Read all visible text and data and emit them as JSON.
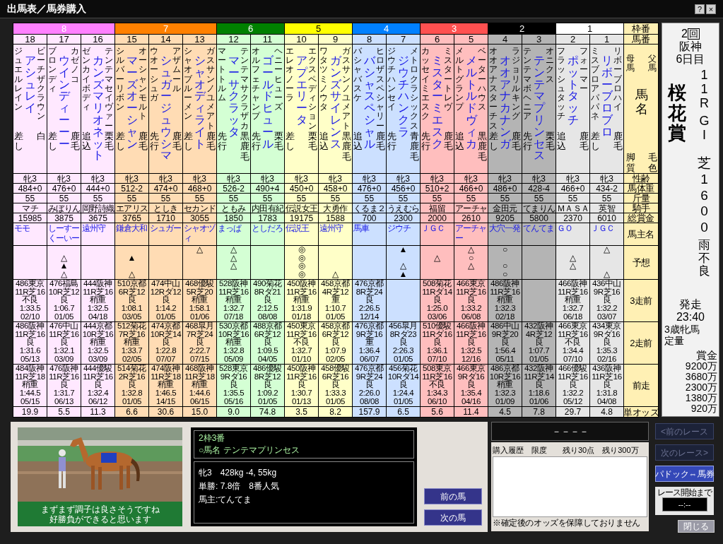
{
  "window": {
    "title": "出馬表／馬券購入",
    "help_button": "?",
    "close_button": "×"
  },
  "row_labels": {
    "frame": "枠番",
    "number": "馬番",
    "sire": "父馬",
    "dam": "母馬",
    "name": "馬名",
    "coat": "毛色",
    "style": "脚質",
    "sex_age": "性齢",
    "weight": "馬体重",
    "load": "斤量",
    "jockey": "騎手",
    "earnings": "総賞金",
    "owner": "馬主名",
    "prediction": "予想",
    "race3": "3走前",
    "race2": "2走前",
    "race1": "前走",
    "odds": "単オッズ"
  },
  "frames": [
    {
      "label": "8",
      "color": "#ff80ff",
      "horses": [
        {
          "number": "18",
          "sire": "ビーチザクラウン",
          "dam": "ジュエルレイン",
          "name": "アシュレイ",
          "style": "差し",
          "coat": "白",
          "sex_age": "牝3",
          "weight": "484+0",
          "load": "55",
          "jockey": "マチ",
          "earnings": "15985",
          "owner": "モモ",
          "predictions": [
            {
              "kind": "blank"
            },
            {
              "kind": "blank"
            },
            {
              "kind": "blank"
            },
            {
              "kind": "blank"
            }
          ],
          "past_races": [
            {
              "venue": "486東京",
              "race": "11R芝16",
              "going": "不良",
              "time": "1:33.5",
              "date": "02/10"
            },
            {
              "venue": "486阪神",
              "race": "11R芝16",
              "going": "良",
              "time": "1:31.6",
              "date": "05/13"
            },
            {
              "venue": "484阪神",
              "race": "11R芝18",
              "going": "稍重",
              "time": "1:44.5",
              "date": "05/15"
            }
          ],
          "odds": "19.9"
        },
        {
          "number": "17",
          "sire": "カゼノコ",
          "dam": "ブロンディ",
          "name": "ウインディーーー",
          "style": "差し",
          "coat": "鹿毛",
          "sex_age": "牝3",
          "weight": "476+0",
          "load": "55",
          "jockey": "みぼりん",
          "earnings": "3875",
          "owner": "しーすーくーいー",
          "predictions": [
            {
              "kind": "blank"
            },
            {
              "kind": "mark",
              "mark": "△"
            },
            {
              "kind": "mark",
              "mark": "▲"
            },
            {
              "kind": "mark",
              "mark": "△"
            }
          ],
          "past_races": [
            {
              "venue": "476福島",
              "race": "10R芝12",
              "going": "良",
              "time": "1:06.7",
              "date": "01/05"
            },
            {
              "venue": "476中山",
              "race": "11R芝16",
              "going": "良",
              "time": "1:32.1",
              "date": "03/09"
            },
            {
              "venue": "476阪神",
              "race": "11R芝16",
              "going": "良",
              "time": "1:31.7",
              "date": "06/13"
            }
          ],
          "odds": "5.5"
        },
        {
          "number": "16",
          "sire": "テンテマセイヴァー",
          "dam": "ゼンカイボディ",
          "name": "カンズマリオネット",
          "style": "追込",
          "coat": "栗毛",
          "sex_age": "牝3",
          "weight": "444+0",
          "load": "55",
          "jockey": "岡野詩織",
          "earnings": "3675",
          "owner": "遠州守",
          "predictions": [
            {
              "kind": "blank"
            },
            {
              "kind": "blank"
            },
            {
              "kind": "blank"
            },
            {
              "kind": "blank"
            }
          ],
          "past_races": [
            {
              "venue": "444阪神",
              "race": "11R芝16",
              "going": "稍重",
              "time": "1:32.5",
              "date": "04/18"
            },
            {
              "venue": "444京都",
              "race": "10R芝16",
              "going": "稍重",
              "time": "1:32.5",
              "date": "03/09"
            },
            {
              "venue": "444優駿",
              "race": "11R芝16",
              "going": "良",
              "time": "1:32.4",
              "date": "06/12"
            }
          ],
          "odds": "11.3"
        }
      ]
    },
    {
      "label": "7",
      "color": "#ff8000",
      "horses": [
        {
          "number": "15",
          "sire": "オーシャンモルト",
          "dam": "シルバーリボン",
          "name": "マーズオーシャン",
          "style": "差し",
          "coat": "鹿毛",
          "sex_age": "牝3",
          "weight": "512-2",
          "load": "55",
          "jockey": "エアリス",
          "earnings": "3765",
          "owner": "鎌倉大和",
          "predictions": [
            {
              "kind": "blank"
            },
            {
              "kind": "mark",
              "mark": "▲"
            },
            {
              "kind": "blank"
            },
            {
              "kind": "mark",
              "mark": "△"
            }
          ],
          "past_races": [
            {
              "venue": "510京都",
              "race": "6R芝12",
              "going": "良",
              "time": "1:08.1",
              "date": "03/05"
            },
            {
              "venue": "512菊花",
              "race": "7R芝16",
              "going": "稍重",
              "time": "1:33.7",
              "date": "02/05"
            },
            {
              "venue": "514菊花",
              "race": "2R芝16",
              "going": "良",
              "time": "1:32.8",
              "date": "01/05"
            }
          ],
          "odds": "6.6"
        },
        {
          "number": "14",
          "sire": "アザムール",
          "dam": "ウオーシュガ",
          "name": "シュガージュウシマ",
          "style": "先行",
          "coat": "鹿毛",
          "sex_age": "牝3",
          "weight": "474+0",
          "load": "55",
          "jockey": "としき",
          "earnings": "1710",
          "owner": "シュガー",
          "predictions": [
            {
              "kind": "blank"
            },
            {
              "kind": "blank"
            },
            {
              "kind": "blank"
            },
            {
              "kind": "blank"
            }
          ],
          "past_races": [
            {
              "venue": "474中山",
              "race": "12Rダ12",
              "going": "良",
              "time": "1:14.2",
              "date": "01/05"
            },
            {
              "venue": "474京都",
              "race": "10R芝14",
              "going": "良",
              "time": "1:22.8",
              "date": "07/07"
            },
            {
              "venue": "474阪神",
              "race": "11R芝18",
              "going": "稍重",
              "time": "1:46.5",
              "date": "14/15"
            }
          ],
          "odds": "30.6"
        },
        {
          "number": "13",
          "sire": "ガスサンノユメアト",
          "dam": "シャオブルーメン",
          "name": "シャオディライト",
          "style": "差し",
          "coat": "鹿毛",
          "sex_age": "牝3",
          "weight": "468+0",
          "load": "55",
          "jockey": "セカンド",
          "earnings": "3055",
          "owner": "シャオヅィ",
          "predictions": [
            {
              "kind": "mark",
              "mark": "△"
            },
            {
              "kind": "blank"
            },
            {
              "kind": "blank"
            },
            {
              "kind": "blank"
            }
          ],
          "past_races": [
            {
              "venue": "468優駿",
              "race": "5R芝20",
              "going": "稍重",
              "time": "1:58.1",
              "date": "01/06"
            },
            {
              "venue": "468皐月",
              "race": "7R芝24",
              "going": "良",
              "time": "2:22.7",
              "date": "07/15"
            },
            {
              "venue": "468阪神",
              "race": "11R芝18",
              "going": "稍重",
              "time": "1:44.6",
              "date": "06/15"
            }
          ],
          "odds": "15.0"
        }
      ]
    },
    {
      "label": "6",
      "color": "#008000",
      "horses": [
        {
          "number": "12",
          "sire": "テンテマサクラザカ",
          "dam": "マートトルム",
          "name": "マーサクラッタ",
          "style": "先行",
          "coat": "黒鹿毛",
          "sex_age": "牝3",
          "weight": "526-2",
          "load": "55",
          "jockey": "ともみ",
          "earnings": "1850",
          "owner": "まっぱ",
          "predictions": [
            {
              "kind": "mark",
              "mark": "△"
            },
            {
              "kind": "mark",
              "mark": "△"
            },
            {
              "kind": "mark",
              "mark": "△"
            },
            {
              "kind": "blank"
            }
          ],
          "past_races": [
            {
              "venue": "528阪神",
              "race": "11R芝16",
              "going": "稍重",
              "time": "1:32.7",
              "date": "07/18"
            },
            {
              "venue": "530京都",
              "race": "10R芝16",
              "going": "稍重",
              "time": "1:32.8",
              "date": "05/09"
            },
            {
              "venue": "528東京",
              "race": "9Rダ16",
              "going": "良",
              "time": "1:35.5",
              "date": "05/16"
            }
          ],
          "odds": "9.0"
        },
        {
          "number": "11",
          "sire": "ヘニーヒューズ",
          "dam": "オルフェチャンプ",
          "name": "ゴールドヒュール",
          "style": "先行",
          "coat": "栗毛",
          "sex_age": "牝3",
          "weight": "490+4",
          "load": "55",
          "jockey": "内田有紀",
          "earnings": "1783",
          "owner": "としだろ",
          "predictions": [
            {
              "kind": "blank"
            },
            {
              "kind": "blank"
            },
            {
              "kind": "blank"
            },
            {
              "kind": "blank"
            }
          ],
          "past_races": [
            {
              "venue": "490菊花",
              "race": "8Rダ21",
              "going": "良",
              "time": "2:12.5",
              "date": "08/08"
            },
            {
              "venue": "488京都",
              "race": "6R芝12",
              "going": "良",
              "time": "1:09.5",
              "date": "04/05"
            },
            {
              "venue": "486優駿",
              "race": "8R芝12",
              "going": "良",
              "time": "1:09.2",
              "date": "01/05"
            }
          ],
          "odds": "74.8"
        }
      ]
    },
    {
      "label": "5",
      "color": "#ffff00",
      "horses": [
        {
          "number": "10",
          "sire": "エクスペディション",
          "dam": "エレオノーラ",
          "name": "アプエリータ",
          "style": "差し",
          "coat": "栗毛",
          "sex_age": "牝3",
          "weight": "450+0",
          "load": "55",
          "jockey": "伝説女王",
          "earnings": "19175",
          "owner": "伝説王",
          "predictions": [
            {
              "kind": "mark",
              "mark": "◎"
            },
            {
              "kind": "mark",
              "mark": "◎"
            },
            {
              "kind": "mark",
              "mark": "◎"
            },
            {
              "kind": "mark",
              "mark": "◎"
            }
          ],
          "past_races": [
            {
              "venue": "450阪神",
              "race": "11R芝16",
              "going": "稍重",
              "time": "1:31.9",
              "date": "01/18"
            },
            {
              "venue": "450東京",
              "race": "11R芝16",
              "going": "不良",
              "time": "1:32.7",
              "date": "01/10"
            },
            {
              "venue": "450阪神",
              "race": "11R芝16",
              "going": "良",
              "time": "1:30.7",
              "date": "01/13"
            }
          ],
          "odds": "3.5"
        },
        {
          "number": "9",
          "sire": "ガスサンノユメアト",
          "dam": "ワタツミノウタ",
          "name": "ガンズサイレンス",
          "style": "追込",
          "coat": "黒鹿毛",
          "sex_age": "牝3",
          "weight": "458+0",
          "load": "55",
          "jockey": "大勇作",
          "earnings": "1588",
          "owner": "遠州守",
          "predictions": [
            {
              "kind": "blank"
            },
            {
              "kind": "blank"
            },
            {
              "kind": "blank"
            },
            {
              "kind": "mark",
              "mark": "△"
            }
          ],
          "past_races": [
            {
              "venue": "458京都",
              "race": "4R芝12",
              "going": "重",
              "time": "1:10.7",
              "date": "01/05"
            },
            {
              "venue": "458京都",
              "race": "6R芝12",
              "going": "良",
              "time": "1:07.9",
              "date": "02/05"
            },
            {
              "venue": "458優駿",
              "race": "6R芝16",
              "going": "良",
              "time": "1:33.3",
              "date": "01/05"
            }
          ],
          "odds": "8.2"
        }
      ]
    },
    {
      "label": "4",
      "color": "#0080ff",
      "horses": [
        {
          "number": "8",
          "sire": "ヒロザスペシャリー",
          "dam": "バシャバスケ",
          "name": "バシャスペシャル",
          "style": "追込",
          "coat": "鹿毛",
          "sex_age": "牝3",
          "weight": "476+0",
          "load": "55",
          "jockey": "くるま２",
          "earnings": "700",
          "owner": "馬車",
          "predictions": [
            {
              "kind": "blank"
            },
            {
              "kind": "blank"
            },
            {
              "kind": "blank"
            },
            {
              "kind": "blank"
            }
          ],
          "past_races": [
            {
              "venue": "476京都",
              "race": "8R芝24",
              "going": "良",
              "time": "2:26.5",
              "date": "12/14"
            },
            {
              "venue": "476京都",
              "race": "9R芝16",
              "going": "重",
              "time": "1:36.4",
              "date": "06/07"
            },
            {
              "venue": "476京都",
              "race": "9R芝24",
              "going": "良",
              "time": "2:26.0",
              "date": "08/08"
            }
          ],
          "odds": "157.9"
        },
        {
          "number": "7",
          "sire": "メトロクラシックス",
          "dam": "ジウチハンセイ",
          "name": "ジウチハンクラ",
          "style": "先行",
          "coat": "青鹿毛",
          "sex_age": "牝3",
          "weight": "456+0",
          "load": "55",
          "jockey": "うえむら",
          "earnings": "2300",
          "owner": "ジウチ",
          "predictions": [
            {
              "kind": "mark",
              "mark": "▲"
            },
            {
              "kind": "blank"
            },
            {
              "kind": "mark",
              "mark": "△"
            },
            {
              "kind": "mark",
              "mark": "▲"
            }
          ],
          "past_races": [
            {
              "venue": "456皐月",
              "race": "8Rダ23",
              "going": "良",
              "time": "2:26.3",
              "date": "01/05"
            },
            {
              "venue": "456菊花",
              "race": "10Rダ14",
              "going": "良",
              "time": "1:24.4",
              "date": "01/05"
            }
          ],
          "odds": "6.5"
        }
      ]
    },
    {
      "label": "3",
      "color": "#ff5050",
      "horses": [
        {
          "number": "6",
          "sire": "ミスタートレヴ",
          "dam": "カッセイミエスク",
          "name": "ミスターミエスク",
          "style": "先行",
          "coat": "鹿毛",
          "sex_age": "牝3",
          "weight": "510+2",
          "load": "55",
          "jockey": "福留",
          "earnings": "2000",
          "owner": "ＪＧＣ",
          "predictions": [
            {
              "kind": "blank"
            },
            {
              "kind": "mark",
              "mark": "△"
            },
            {
              "kind": "blank"
            },
            {
              "kind": "blank"
            }
          ],
          "past_races": [
            {
              "venue": "508菊花",
              "race": "11Rダ14",
              "going": "良",
              "time": "1:25.0",
              "date": "03/06"
            },
            {
              "venue": "510優駿",
              "race": "11Rダ16",
              "going": "良",
              "time": "1:36.1",
              "date": "07/10"
            },
            {
              "venue": "508東京",
              "race": "11R芝16",
              "going": "不良",
              "time": "1:34.3",
              "date": "06/10"
            }
          ],
          "odds": "5.6"
        },
        {
          "number": "5",
          "sire": "ベーターハウス",
          "dam": "メルトグランプ",
          "name": "メルトルドヴィカ",
          "style": "追込",
          "coat": "黒鹿毛",
          "sex_age": "牝3",
          "weight": "466+0",
          "load": "55",
          "jockey": "アーチャ",
          "earnings": "2610",
          "owner": "アーチャー",
          "predictions": [
            {
              "kind": "mark",
              "mark": "△"
            },
            {
              "kind": "mark",
              "mark": "○"
            },
            {
              "kind": "mark",
              "mark": "△"
            },
            {
              "kind": "blank"
            }
          ],
          "past_races": [
            {
              "venue": "466東京",
              "race": "11R芝16",
              "going": "良",
              "time": "1:33.2",
              "date": "06/08"
            },
            {
              "venue": "466阪神",
              "race": "11R芝16",
              "going": "良",
              "time": "1:32.5",
              "date": "12/16"
            },
            {
              "venue": "466東京",
              "race": "9Rダ16",
              "going": "良",
              "time": "1:35.4",
              "date": "04/16"
            }
          ],
          "odds": "11.4"
        }
      ]
    },
    {
      "label": "2",
      "color": "#000000",
      "horses": [
        {
          "number": "4",
          "sire": "ラジョリルキング",
          "dam": "オオアナスターチス",
          "name": "オオアナカナンガ",
          "style": "差し",
          "coat": "鹿毛",
          "sex_age": "牝3",
          "weight": "486+0",
          "load": "55",
          "jockey": "金田元",
          "earnings": "9205",
          "owner": "大穴一発",
          "predictions": [
            {
              "kind": "mark",
              "mark": "○"
            },
            {
              "kind": "blank"
            },
            {
              "kind": "mark",
              "mark": "○"
            },
            {
              "kind": "mark",
              "mark": "○"
            }
          ],
          "past_races": [
            {
              "venue": "486阪神",
              "race": "11R芝16",
              "going": "稍重",
              "time": "1:32.3",
              "date": "02/18"
            },
            {
              "venue": "486中山",
              "race": "9R芝20",
              "going": "良",
              "time": "1:56.4",
              "date": "05/11"
            },
            {
              "venue": "486京都",
              "race": "10R芝16",
              "going": "稍重",
              "time": "1:32.3",
              "date": "01/09"
            }
          ],
          "odds": "4.5"
        },
        {
          "number": "3",
          "sire": "オニクス",
          "dam": "テンテマボヘニア",
          "name": "テンテマプリンセス",
          "style": "先行",
          "coat": "栗毛",
          "sex_age": "牝3",
          "weight": "428-4",
          "load": "55",
          "jockey": "てまりん",
          "earnings": "5800",
          "owner": "てんてま",
          "predictions": [
            {
              "kind": "blank"
            },
            {
              "kind": "blank"
            },
            {
              "kind": "blank"
            },
            {
              "kind": "blank"
            }
          ],
          "past_races": [
            {
              "venue": "432阪神",
              "race": "4R芝12",
              "going": "良",
              "time": "1:07.7",
              "date": "01/05"
            },
            {
              "venue": "432阪神",
              "race": "11R芝14",
              "going": "良",
              "time": "1:18.6",
              "date": "01/06"
            }
          ],
          "odds": "7.8"
        }
      ]
    },
    {
      "label": "1",
      "color": "#ffffff",
      "horses": [
        {
          "number": "2",
          "sire": "フォーマー",
          "dam": "フラッシュタッチ",
          "name": "ポットタッチ",
          "style": "追込",
          "coat": "鹿毛",
          "sex_age": "牝3",
          "weight": "466+0",
          "load": "55",
          "jockey": "ＭＡＳＡ",
          "earnings": "2370",
          "owner": "ＧＯ",
          "predictions": [
            {
              "kind": "blank"
            },
            {
              "kind": "mark",
              "mark": "△"
            },
            {
              "kind": "mark",
              "mark": "△"
            },
            {
              "kind": "blank"
            }
          ],
          "past_races": [
            {
              "venue": "466阪神",
              "race": "11R芝16",
              "going": "稍重",
              "time": "1:32.7",
              "date": "06/18"
            },
            {
              "venue": "466東京",
              "race": "11R芝16",
              "going": "不良",
              "time": "1:34.4",
              "date": "07/10"
            },
            {
              "venue": "466優駿",
              "race": "11R芝16",
              "going": "良",
              "time": "1:32.2",
              "date": "05/12"
            }
          ],
          "odds": "29.7"
        },
        {
          "number": "1",
          "sire": "リボーブロハイ",
          "dam": "ミスブロアパパネ",
          "name": "リボーブロブロ",
          "style": "差し",
          "coat": "鹿毛",
          "sex_age": "牝3",
          "weight": "434-2",
          "load": "55",
          "jockey": "英智",
          "earnings": "6010",
          "owner": "ＪＧＣ",
          "predictions": [
            {
              "kind": "mark",
              "mark": "△"
            },
            {
              "kind": "blank"
            },
            {
              "kind": "blank"
            },
            {
              "kind": "mark",
              "mark": "△"
            }
          ],
          "past_races": [
            {
              "venue": "436中山",
              "race": "9R芝16",
              "going": "良",
              "time": "1:32.2",
              "date": "03/07"
            },
            {
              "venue": "434東京",
              "race": "9Rダ16",
              "going": "良",
              "time": "1:35.3",
              "date": "02/16"
            },
            {
              "venue": "436阪神",
              "race": "11R芝16",
              "going": "良",
              "time": "1:31.8",
              "date": "04/08"
            }
          ],
          "odds": "4.8"
        }
      ]
    }
  ],
  "race_info": {
    "meeting": "2",
    "meeting_unit": "回",
    "venue": "阪神",
    "day": "6日目",
    "race_name": "桜花賞",
    "race_number": "11R",
    "grade": "GI",
    "course": "芝1600",
    "weather": "雨",
    "going": "不良",
    "start_label": "発走",
    "start_time": "23:40",
    "conditions": "3歳牝馬",
    "weight_rule": "定量",
    "prize_label": "賞金",
    "prizes": [
      "9200万",
      "3680万",
      "2300万",
      "1380万",
      "920万"
    ]
  },
  "paddock": {
    "comment_lines": [
      "まずまず調子は良さそうですね",
      "好勝負ができると思います"
    ],
    "header_lines": [
      "2枠3番",
      "○馬名 テンテマプリンセス"
    ],
    "detail_lines": [
      "牝3　428kg -4, 55kg",
      "単勝: 7.8倍　8番人気",
      "馬主:てんてま"
    ],
    "prev_horse": "前の馬",
    "next_horse": "次の馬"
  },
  "purchase": {
    "display": "－－－－",
    "history_header": "購入履歴　限度　　残り30点　残り300万",
    "note": "※確定後のオッズを保障しておりません"
  },
  "side_buttons": [
    {
      "label": "<前のレース",
      "disabled": true
    },
    {
      "label": "次のレース>",
      "disabled": true
    },
    {
      "label": "パドック⇔馬券",
      "disabled": false
    }
  ],
  "countdown": {
    "label": "レース開始まで",
    "value": "--:--"
  },
  "close_button": "閉じる"
}
